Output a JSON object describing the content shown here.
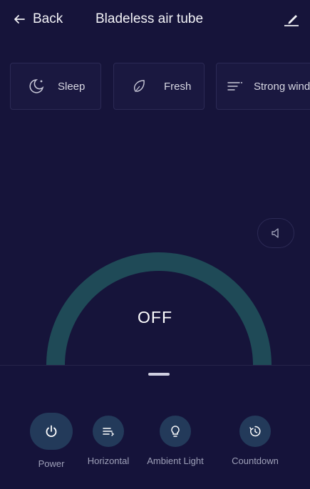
{
  "header": {
    "back_label": "Back",
    "title": "Bladeless air tube"
  },
  "modes": [
    {
      "label": "Sleep",
      "icon": "moon-icon"
    },
    {
      "label": "Fresh",
      "icon": "leaf-icon"
    },
    {
      "label": "Strong wind",
      "icon": "wind-lines-icon"
    }
  ],
  "status": {
    "power_text": "OFF"
  },
  "controls": [
    {
      "label": "Power",
      "icon": "power-icon"
    },
    {
      "label": "Horizontal",
      "icon": "horizontal-swing-icon"
    },
    {
      "label": "Ambient Light",
      "icon": "light-bulb-icon"
    },
    {
      "label": "Countdown",
      "icon": "timer-icon"
    }
  ],
  "colors": {
    "background": "#16143a",
    "arc": "#1f4a57",
    "control_button": "#233a5a"
  }
}
